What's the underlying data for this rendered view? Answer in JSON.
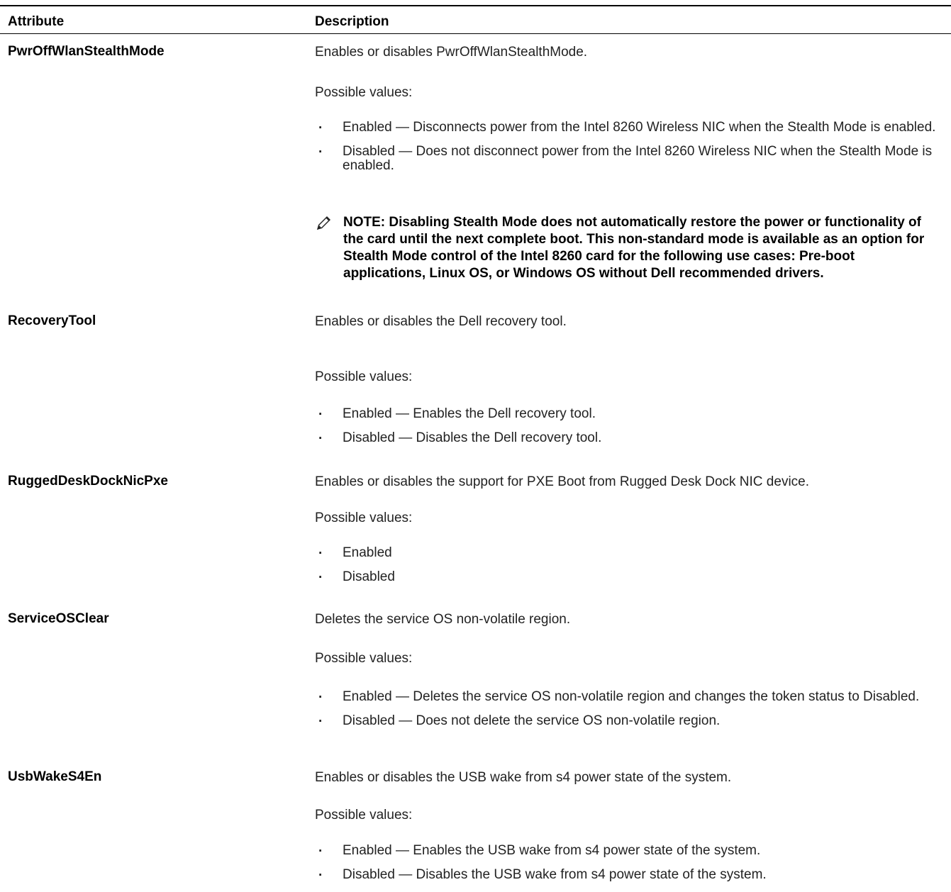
{
  "table": {
    "headers": {
      "attribute": "Attribute",
      "description": "Description"
    },
    "possible_values_label": "Possible values:",
    "rows": [
      {
        "attribute": "PwrOffWlanStealthMode",
        "description": "Enables or disables PwrOffWlanStealthMode.",
        "values": [
          "Enabled — Disconnects power from the Intel 8260 Wireless NIC when the Stealth Mode is enabled.",
          "Disabled — Does not disconnect power from the Intel 8260 Wireless NIC when the Stealth Mode is enabled."
        ],
        "note": "NOTE: Disabling Stealth Mode does not automatically restore the power or functionality of the card until the next complete boot. This non-standard mode is available as an option for Stealth Mode control of the Intel 8260 card for the following use cases: Pre-boot applications, Linux OS, or Windows OS without Dell recommended drivers."
      },
      {
        "attribute": "RecoveryTool",
        "description": "Enables or disables the Dell recovery tool.",
        "values": [
          "Enabled — Enables the Dell recovery tool.",
          "Disabled — Disables the Dell recovery tool."
        ]
      },
      {
        "attribute": "RuggedDeskDockNicPxe",
        "description": "Enables or disables the support for PXE Boot from Rugged Desk Dock NIC device.",
        "values": [
          "Enabled",
          "Disabled"
        ]
      },
      {
        "attribute": "ServiceOSClear",
        "description": "Deletes the service OS non-volatile region.",
        "values": [
          "Enabled — Deletes the service OS non-volatile region and changes the token status to Disabled.",
          "Disabled — Does not delete the service OS non-volatile region."
        ]
      },
      {
        "attribute": "UsbWakeS4En",
        "description": "Enables or disables the USB wake from s4 power state of the system.",
        "values": [
          "Enabled — Enables the USB wake from s4 power state of the system.",
          "Disabled — Disables the USB wake from s4 power state of the system."
        ]
      }
    ]
  }
}
